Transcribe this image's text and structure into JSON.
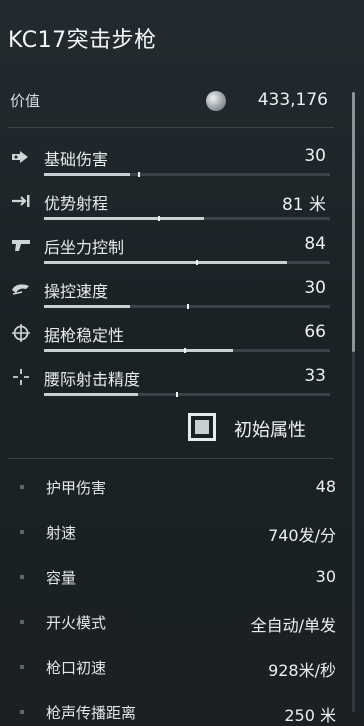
{
  "weapon": {
    "name": "KC17突击步枪"
  },
  "value": {
    "label": "价值",
    "amount": "433,176",
    "icon": "silver-coin-icon"
  },
  "stats": [
    {
      "label": "基础伤害",
      "value": "30",
      "icon": "damage-icon",
      "fill": 0.3,
      "base": 0.33
    },
    {
      "label": "优势射程",
      "value": "81 米",
      "icon": "range-icon",
      "fill": 0.56,
      "base": 0.4
    },
    {
      "label": "后坐力控制",
      "value": "84",
      "icon": "recoil-control-icon",
      "fill": 0.85,
      "base": 0.53
    },
    {
      "label": "操控速度",
      "value": "30",
      "icon": "handling-speed-icon",
      "fill": 0.3,
      "base": 0.5
    },
    {
      "label": "据枪稳定性",
      "value": "66",
      "icon": "stability-icon",
      "fill": 0.66,
      "base": 0.49
    },
    {
      "label": "腰际射击精度",
      "value": "33",
      "icon": "hipfire-accuracy-icon",
      "fill": 0.33,
      "base": 0.46
    }
  ],
  "toggle": {
    "label": "初始属性",
    "checked": true
  },
  "attributes": [
    {
      "label": "护甲伤害",
      "value": "48"
    },
    {
      "label": "射速",
      "value": "740发/分"
    },
    {
      "label": "容量",
      "value": "30"
    },
    {
      "label": "开火模式",
      "value": "全自动/单发"
    },
    {
      "label": "枪口初速",
      "value": "928米/秒"
    },
    {
      "label": "枪声传播距离",
      "value": "250 米"
    }
  ]
}
